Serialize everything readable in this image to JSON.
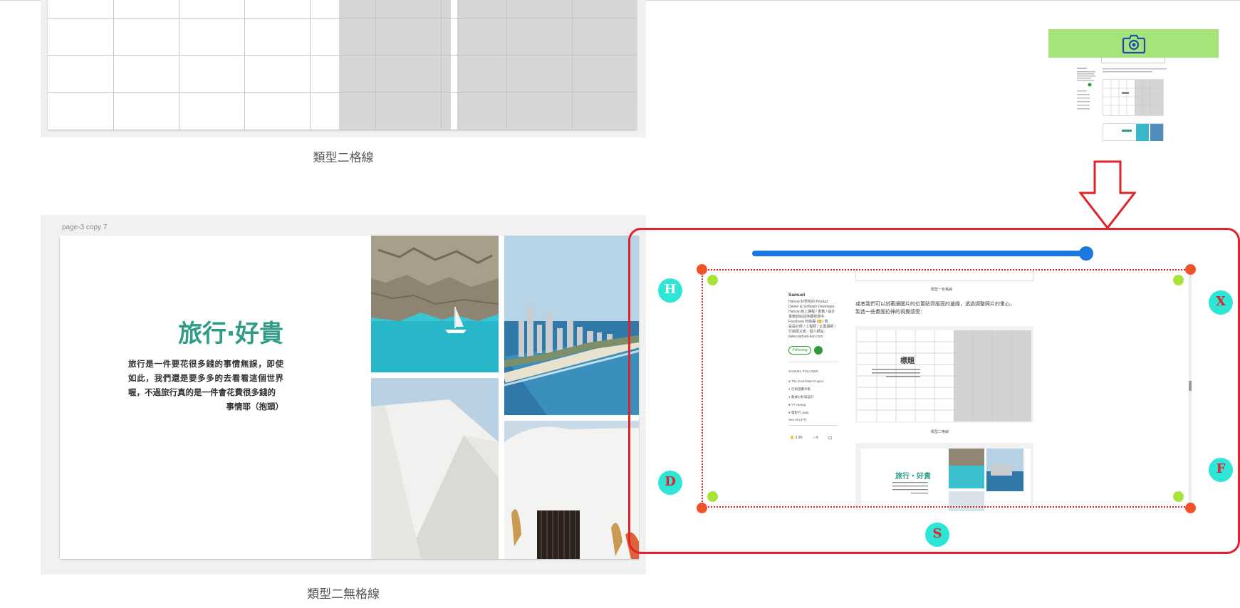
{
  "captions": {
    "figure1": "類型二格線",
    "figure2": "類型二無格線"
  },
  "figure2": {
    "artboard_label": "page-3 copy 7",
    "title": "旅行‧好貴",
    "body": "旅行是一件要花很多錢的事情無誤，即使如此，我們還是要多多的去看看這個世界喔，不過旅行真的是一件會花費很多錢的",
    "body_last": "事情耶（抱頭）"
  },
  "annotations": {
    "circle_labels": [
      "H",
      "X",
      "D",
      "F",
      "S"
    ],
    "colors": {
      "frame": "#e0222a",
      "slider": "#1a78e0",
      "handle_corner": "#f0522a",
      "handle_inner": "#a6e43a",
      "label_bg": "#2ee6d6",
      "thumb_bar": "#a5e47a"
    },
    "icons": {
      "camera": "camera-icon",
      "arrow": "down-arrow-icon"
    }
  },
  "preview": {
    "top_caption": "類型一有格線",
    "author_name": "Samuel",
    "author_bio": [
      "Hahow 好學校的 Product",
      "Owner & Software Developer,",
      "Hahow 線上課程 / 書籍 / 設計",
      "書籍創始並持續營運中",
      "Facebook 粉絲團 (😊) 我",
      "是設計師 / 工程師 / 企業講師 /",
      "行銷撰文者 - 個人網站：",
      "www.samuel-kao.com"
    ],
    "follow_label": "Following",
    "followers_heading": "SAMUEL FOLLOWS",
    "followers": [
      "The Good Man Project",
      "行銷漫畫手帳",
      "數據分析與設計",
      "YT Huang",
      "電影行 Jade"
    ],
    "see_all": "See all (377)",
    "clap_count": "3.9K",
    "comment_count": "4",
    "paragraph": "或者我們可以試著讓圖片的位置貼齊版面的邊緣，透過調整照片的重心，",
    "paragraph2": "製造一些畫面拉伸的視覺感受：",
    "grid_title": "標題",
    "grid_caption": "類型二格線",
    "mini_title": "旅行‧好貴"
  }
}
